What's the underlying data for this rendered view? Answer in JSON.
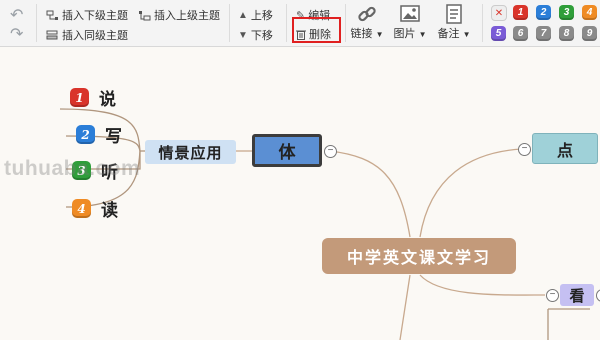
{
  "toolbar": {
    "insert_child": "插入下级主题",
    "insert_parent": "插入上级主题",
    "insert_sibling": "插入同级主题",
    "move_up": "上移",
    "move_down": "下移",
    "edit": "编辑",
    "delete": "删除",
    "link": "链接",
    "image": "图片",
    "note": "备注",
    "priorities_row1": [
      "1",
      "2",
      "3",
      "4"
    ],
    "priorities_row2": [
      "5",
      "6",
      "7",
      "8",
      "9"
    ]
  },
  "colors": {
    "priority_1": "#d9342a",
    "priority_2": "#2b7ed8",
    "priority_3": "#2f9e3a",
    "priority_4": "#ef8b24",
    "priority_5": "#7a5bd6",
    "priority_gray": "#8a8a8a",
    "root_fill": "#c39a7a",
    "highlight": "#e02020"
  },
  "mindmap": {
    "root": "中学英文课文学习",
    "branch_ti": "体",
    "branch_dian": "点",
    "branch_kan": "看",
    "sub_scene": "情景应用",
    "leaves": [
      {
        "n": "1",
        "label": "说"
      },
      {
        "n": "2",
        "label": "写"
      },
      {
        "n": "3",
        "label": "听"
      },
      {
        "n": "4",
        "label": "读"
      }
    ]
  },
  "watermark": "tuhuaba.com"
}
